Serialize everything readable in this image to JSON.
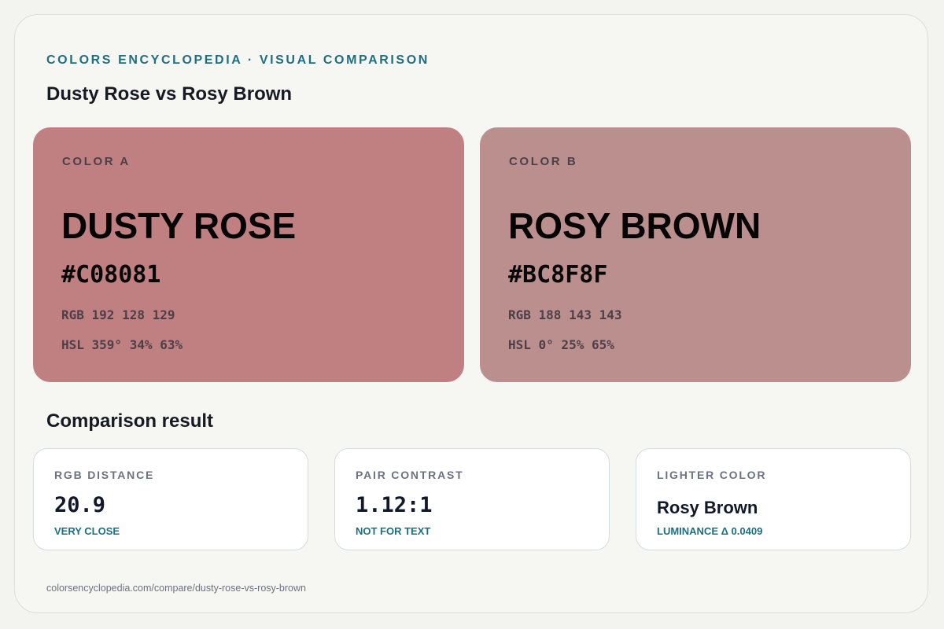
{
  "header": {
    "eyebrow": "COLORS ENCYCLOPEDIA · VISUAL COMPARISON",
    "title": "Dusty Rose vs Rosy Brown"
  },
  "colors": [
    {
      "label": "COLOR A",
      "name": "Dusty Rose",
      "hex": "#C08081",
      "rgb": "RGB 192 128 129",
      "hsl": "HSL 359° 34% 63%",
      "background": "#C08081"
    },
    {
      "label": "COLOR B",
      "name": "Rosy Brown",
      "hex": "#BC8F8F",
      "rgb": "RGB 188 143 143",
      "hsl": "HSL 0° 25% 65%",
      "background": "#BC8F8F"
    }
  ],
  "comparison": {
    "title": "Comparison result",
    "cards": [
      {
        "label": "RGB DISTANCE",
        "value": "20.9",
        "note": "VERY CLOSE"
      },
      {
        "label": "PAIR CONTRAST",
        "value": "1.12:1",
        "note": "NOT FOR TEXT"
      },
      {
        "label": "LIGHTER COLOR",
        "value": "Rosy Brown",
        "note": "LUMINANCE Δ 0.0409"
      }
    ]
  },
  "footer": {
    "url": "colorsencyclopedia.com/compare/dusty-rose-vs-rosy-brown"
  },
  "theme": {
    "accent": "#1D6F82",
    "page_background": "#F6F6F2",
    "card_border": "#D7DBE2"
  }
}
